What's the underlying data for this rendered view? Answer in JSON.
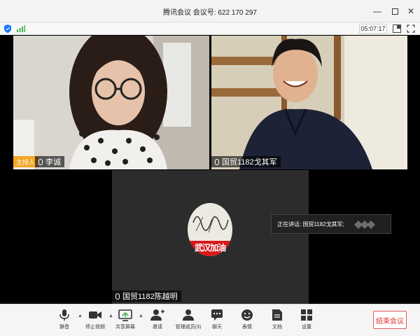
{
  "window": {
    "title": "腾讯会议  会议号: 622 170 297"
  },
  "status": {
    "timer": "05:07:17"
  },
  "participants": [
    {
      "name": "李诚",
      "host_label": "主持人"
    },
    {
      "name": "国贸1182戈其军"
    },
    {
      "name": "国贸1182陈越明",
      "avatar_text": "武汉加油"
    }
  ],
  "speaking": {
    "label": "正在讲话: 国贸1182戈其军;"
  },
  "toolbar": {
    "mute": "静音",
    "stop_video": "停止视频",
    "share_screen": "共享屏幕",
    "invite": "邀请",
    "manage_members": "管理成员(3)",
    "chat": "聊天",
    "reactions": "表情",
    "docs": "文档",
    "settings": "设置",
    "end_meeting": "结束会议"
  },
  "colors": {
    "host_badge": "#f5a623",
    "end_button": "#e0312f",
    "accent_green": "#3fb34f",
    "accent_blue": "#1677ff"
  }
}
